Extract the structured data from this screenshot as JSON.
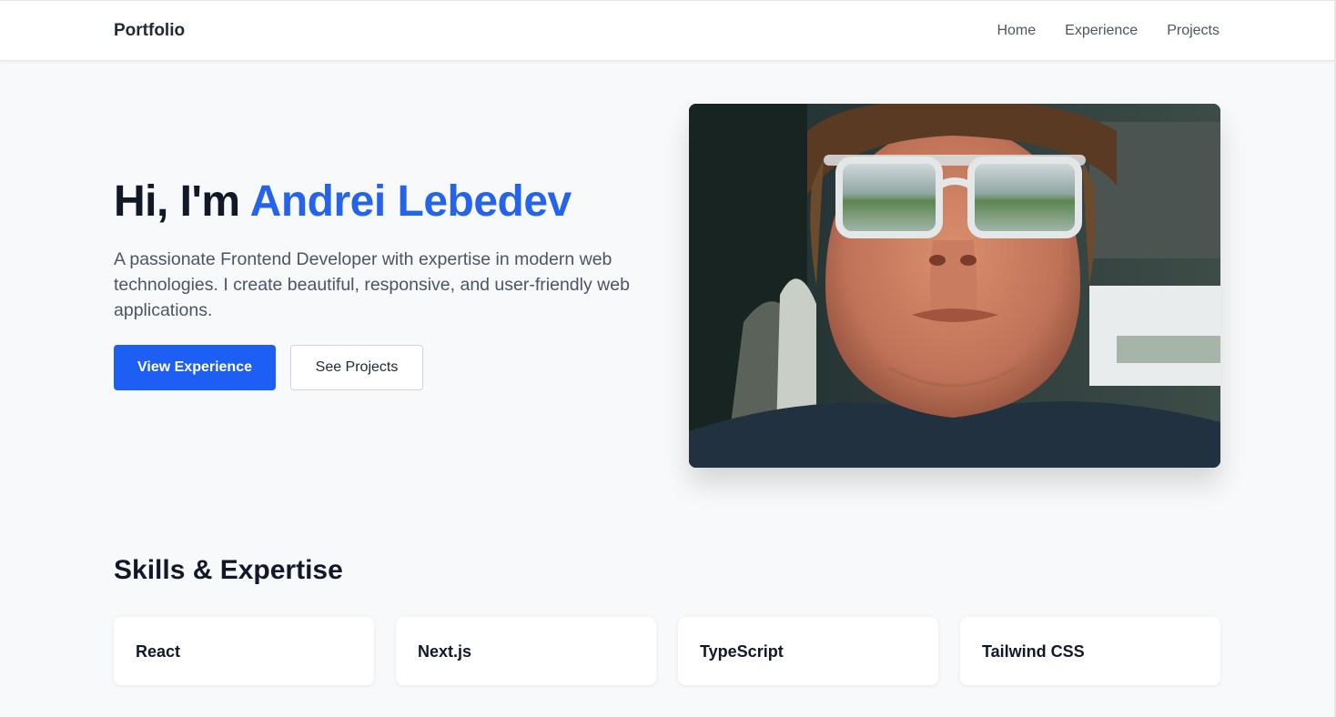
{
  "nav": {
    "brand": "Portfolio",
    "links": [
      "Home",
      "Experience",
      "Projects"
    ]
  },
  "hero": {
    "greeting": "Hi, I'm ",
    "name": "Andrei Lebedev",
    "description": "A passionate Frontend Developer with expertise in modern web technologies. I create beautiful, responsive, and user-friendly web applications.",
    "primary_button": "View Experience",
    "secondary_button": "See Projects"
  },
  "skills": {
    "title": "Skills & Expertise",
    "items": [
      "React",
      "Next.js",
      "TypeScript",
      "Tailwind CSS"
    ]
  },
  "colors": {
    "accent": "#2563eb",
    "primary_button": "#1d5ff5",
    "background": "#f8f9fb"
  }
}
